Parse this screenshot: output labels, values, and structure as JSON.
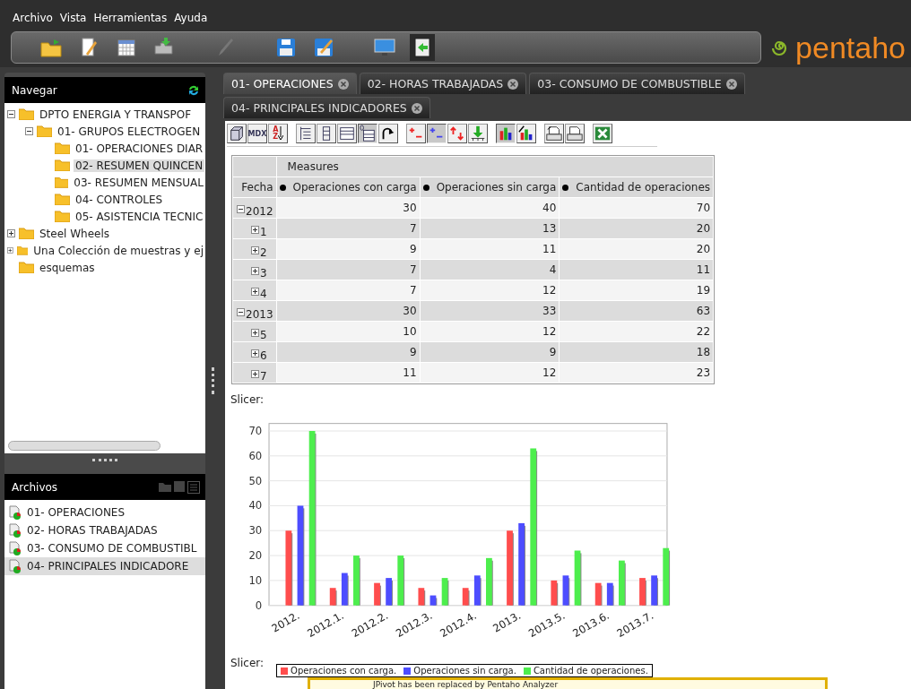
{
  "menu": [
    "Archivo",
    "Vista",
    "Herramientas",
    "Ayuda"
  ],
  "toolbar": [
    {
      "kind": "folder-arrow",
      "pressed": false
    },
    {
      "kind": "document-pencil",
      "pressed": false
    },
    {
      "kind": "calendar",
      "pressed": false
    },
    {
      "kind": "puzzle",
      "pressed": false
    },
    {
      "kind": "pencil",
      "pressed": false
    },
    {
      "kind": "floppy",
      "pressed": false
    },
    {
      "kind": "floppy-pencil",
      "pressed": false
    },
    {
      "kind": "monitor",
      "pressed": false
    },
    {
      "kind": "panel-arrow",
      "pressed": true
    }
  ],
  "logo": "pentaho",
  "navigator": {
    "title": "Navegar",
    "tree": [
      {
        "label": "DPTO ENERGIA Y TRANSPOF",
        "expanded": true,
        "selected": false,
        "children": [
          {
            "label": "01- GRUPOS ELECTROGEN",
            "expanded": true,
            "selected": false,
            "children": [
              {
                "label": "01- OPERACIONES DIAR",
                "selected": false
              },
              {
                "label": "02- RESUMEN QUINCEN",
                "selected": true
              },
              {
                "label": "03- RESUMEN MENSUAL",
                "selected": false
              },
              {
                "label": "04- CONTROLES",
                "selected": false
              },
              {
                "label": "05- ASISTENCIA TECNIC",
                "selected": false
              }
            ]
          }
        ]
      },
      {
        "label": "Steel Wheels",
        "expanded": false,
        "selected": false
      },
      {
        "label": "Una Colección de muestras y ej",
        "expanded": false,
        "selected": false
      },
      {
        "label": "esquemas",
        "selected": false
      }
    ]
  },
  "files": {
    "title": "Archivos",
    "items": [
      {
        "label": "01- OPERACIONES",
        "selected": false
      },
      {
        "label": "02- HORAS TRABAJADAS",
        "selected": false
      },
      {
        "label": "03- CONSUMO DE COMBUSTIBL",
        "selected": false
      },
      {
        "label": "04- PRINCIPALES INDICADORE",
        "selected": true
      }
    ]
  },
  "tabs": [
    {
      "label": "01- OPERACIONES",
      "selected": true
    },
    {
      "label": "02- HORAS TRABAJADAS",
      "selected": false
    },
    {
      "label": "03- CONSUMO DE COMBUSTIBLE",
      "selected": false
    },
    {
      "label": "04- PRINCIPALES INDICADORES",
      "selected": false
    }
  ],
  "pivot_toolbar": [
    [
      {
        "kind": "cube",
        "pressed": false
      },
      {
        "kind": "mdx",
        "label": "MDX",
        "pressed": false
      },
      {
        "kind": "sort",
        "label": "AZ",
        "pressed": false
      }
    ],
    [
      {
        "kind": "tree-list",
        "pressed": false
      },
      {
        "kind": "columns",
        "pressed": false
      },
      {
        "kind": "table",
        "pressed": false
      },
      {
        "kind": "table-zero",
        "pressed": true
      },
      {
        "kind": "swap-arrow",
        "pressed": false
      }
    ],
    [
      {
        "kind": "add-remove",
        "pressed": false
      },
      {
        "kind": "plus-minus",
        "pressed": true
      },
      {
        "kind": "up-down-arrows",
        "pressed": false
      },
      {
        "kind": "download-arrow",
        "pressed": false
      }
    ],
    [
      {
        "kind": "bar-chart",
        "pressed": true
      },
      {
        "kind": "bar-chart-pencil",
        "pressed": false
      }
    ],
    [
      {
        "kind": "printer-settings",
        "pressed": false
      },
      {
        "kind": "printer",
        "pressed": false
      }
    ],
    [
      {
        "kind": "spreadsheet-x",
        "pressed": false
      }
    ]
  ],
  "table": {
    "measures_label": "Measures",
    "row_header": "Fecha",
    "columns": [
      "Operaciones con carga",
      "Operaciones sin carga",
      "Cantidad de operaciones"
    ],
    "rows": [
      {
        "label": "2012",
        "expanded": true,
        "values": [
          "30",
          "40",
          "70"
        ],
        "children": [
          {
            "label": "1",
            "expanded": false,
            "values": [
              "7",
              "13",
              "20"
            ]
          },
          {
            "label": "2",
            "expanded": false,
            "values": [
              "9",
              "11",
              "20"
            ]
          },
          {
            "label": "3",
            "expanded": false,
            "values": [
              "7",
              "4",
              "11"
            ]
          },
          {
            "label": "4",
            "expanded": false,
            "values": [
              "7",
              "12",
              "19"
            ]
          }
        ]
      },
      {
        "label": "2013",
        "expanded": true,
        "values": [
          "30",
          "33",
          "63"
        ],
        "children": [
          {
            "label": "5",
            "expanded": false,
            "values": [
              "10",
              "12",
              "22"
            ]
          },
          {
            "label": "6",
            "expanded": false,
            "values": [
              "9",
              "9",
              "18"
            ]
          },
          {
            "label": "7",
            "expanded": false,
            "values": [
              "11",
              "12",
              "23"
            ]
          }
        ]
      }
    ]
  },
  "slicer_top": "Slicer:",
  "chart_data": {
    "type": "bar",
    "categories": [
      "2012.",
      "2012.1.",
      "2012.2.",
      "2012.3.",
      "2012.4.",
      "2013.",
      "2013.5.",
      "2013.6.",
      "2013.7."
    ],
    "series": [
      {
        "name": "Operaciones con carga.",
        "color": "#ff4d4d",
        "values": [
          30,
          7,
          9,
          7,
          7,
          30,
          10,
          9,
          11
        ]
      },
      {
        "name": "Operaciones sin carga.",
        "color": "#4d4dff",
        "values": [
          40,
          13,
          11,
          4,
          12,
          33,
          12,
          9,
          12
        ]
      },
      {
        "name": "Cantidad de operaciones.",
        "color": "#4dee4d",
        "values": [
          70,
          20,
          20,
          11,
          19,
          63,
          22,
          18,
          23
        ]
      }
    ],
    "ylim": [
      0,
      73
    ],
    "grid": true,
    "yticks": [
      0,
      10,
      20,
      30,
      40,
      50,
      60,
      70
    ]
  },
  "slicer_bottom": "Slicer:",
  "notice": "JPivot has been replaced by Pentaho Analyzer"
}
